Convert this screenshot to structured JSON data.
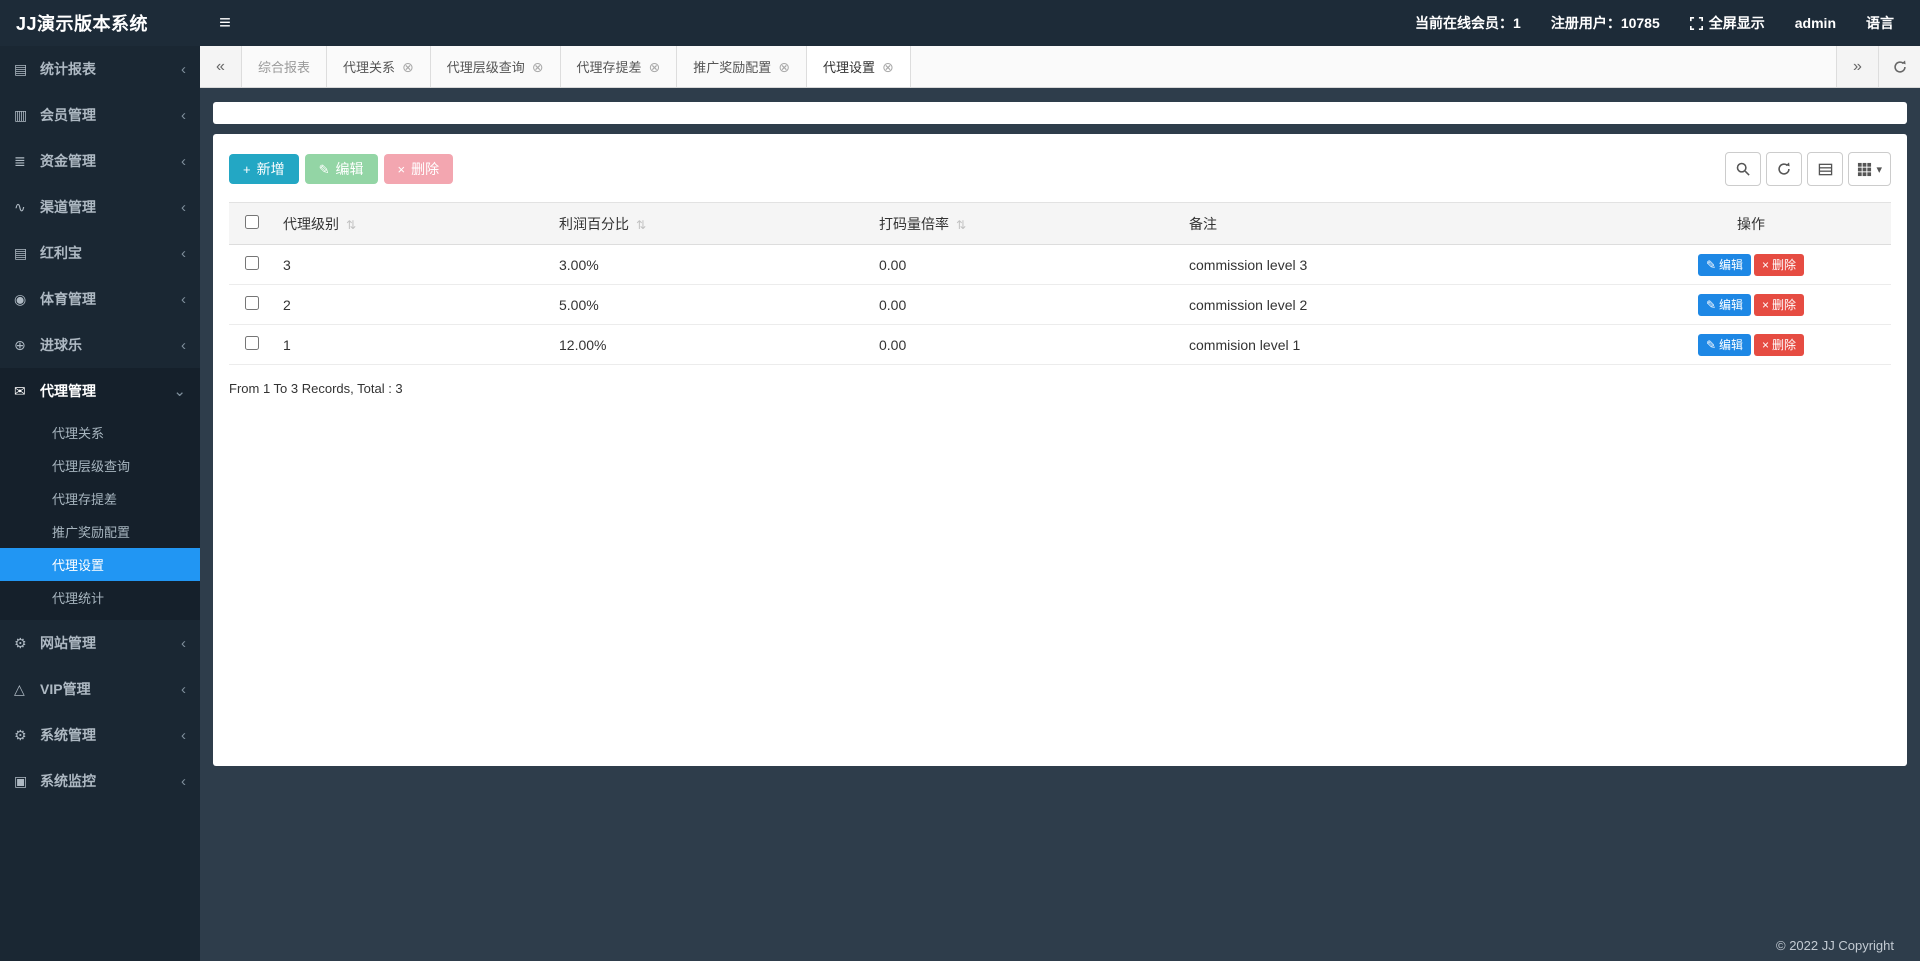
{
  "header": {
    "brand": "JJ演示版本系统",
    "menu_icon": "≡",
    "online": "当前在线会员：1",
    "registered": "注册用户：10785",
    "fullscreen": "全屏显示",
    "username": "admin",
    "language": "语言"
  },
  "sidebar": {
    "collapse_icon": "‹",
    "expand_icon": "⌄",
    "items": [
      {
        "label": "统计报表",
        "icon": "▤"
      },
      {
        "label": "会员管理",
        "icon": "▥"
      },
      {
        "label": "资金管理",
        "icon": "≣"
      },
      {
        "label": "渠道管理",
        "icon": "∿"
      },
      {
        "label": "红利宝",
        "icon": "▤"
      },
      {
        "label": "体育管理",
        "icon": "◉"
      },
      {
        "label": "进球乐",
        "icon": "⊕"
      },
      {
        "label": "代理管理",
        "icon": "✉"
      },
      {
        "label": "网站管理",
        "icon": "⚙"
      },
      {
        "label": "VIP管理",
        "icon": "△"
      },
      {
        "label": "系统管理",
        "icon": "⚙"
      },
      {
        "label": "系统监控",
        "icon": "▣"
      }
    ],
    "submenu": [
      "代理关系",
      "代理层级查询",
      "代理存提差",
      "推广奖励配置",
      "代理设置",
      "代理统计"
    ]
  },
  "tabbar": {
    "back_icon": "«",
    "forward_icon": "»",
    "tabs": [
      {
        "label": "综合报表"
      },
      {
        "label": "代理关系"
      },
      {
        "label": "代理层级查询"
      },
      {
        "label": "代理存提差"
      },
      {
        "label": "推广奖励配置"
      },
      {
        "label": "代理设置"
      }
    ]
  },
  "icons": {
    "add": "+",
    "edit": "✎",
    "delete": "×",
    "close": "⊗",
    "sort": "⇅",
    "caret": "▾"
  },
  "toolbar": {
    "add_label": "新增",
    "edit_label": "编辑",
    "delete_label": "删除"
  },
  "table": {
    "columns": [
      "代理级别",
      "利润百分比",
      "打码量倍率",
      "备注",
      "操作"
    ],
    "rows": [
      {
        "level": "3",
        "profit": "3.00%",
        "rate": "0.00",
        "remark": "commission level 3"
      },
      {
        "level": "2",
        "profit": "5.00%",
        "rate": "0.00",
        "remark": "commission level 2"
      },
      {
        "level": "1",
        "profit": "12.00%",
        "rate": "0.00",
        "remark": "commision level 1"
      }
    ],
    "row_edit": "编辑",
    "row_delete": "删除",
    "summary": "From 1 To 3 Records, Total : 3"
  },
  "footer": {
    "copyright": "© 2022 JJ Copyright"
  }
}
